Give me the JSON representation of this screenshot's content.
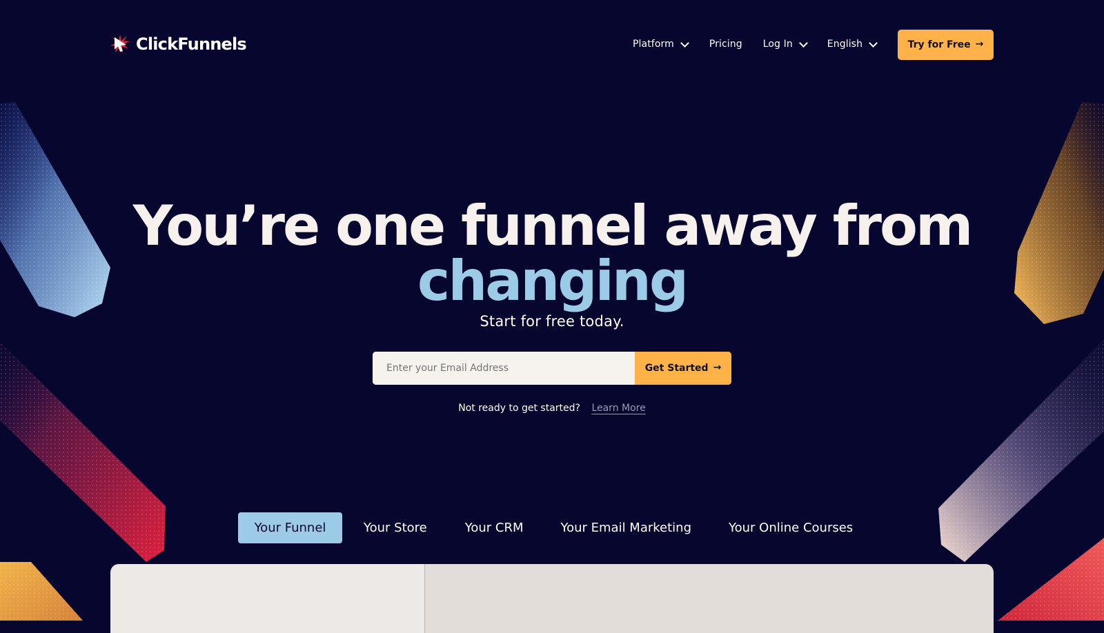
{
  "brand": {
    "name": "ClickFunnels",
    "logo_icon": "cursor-burst-icon",
    "mark_color": "#e8233f"
  },
  "nav": {
    "items": [
      {
        "label": "Platform",
        "icon": "chevron-down-icon"
      },
      {
        "label": "Pricing"
      },
      {
        "label": "Log In",
        "icon": "chevron-down-icon"
      },
      {
        "label": "English",
        "icon": "chevron-down-icon"
      }
    ],
    "cta": {
      "label": "Try for Free",
      "icon": "arrow-right-icon"
    }
  },
  "hero": {
    "title_line1": "You’re one funnel away from",
    "title_line2": "changing",
    "subtitle": "Start for free today.",
    "email_placeholder": "Enter your Email Address",
    "email_value": "",
    "submit_label": "Get Started",
    "submit_icon": "arrow-right-icon",
    "not_ready_text": "Not ready to get started?",
    "learn_more": "Learn More"
  },
  "tabs": [
    {
      "label": "Your Funnel",
      "active": true
    },
    {
      "label": "Your Store",
      "active": false
    },
    {
      "label": "Your CRM",
      "active": false
    },
    {
      "label": "Your Email Marketing",
      "active": false
    },
    {
      "label": "Your Online Courses",
      "active": false
    }
  ],
  "colors": {
    "background": "#07062f",
    "accent_orange": "#ffb247",
    "accent_blue": "#9ccbe7",
    "hero_text": "#f6f1ec",
    "link_muted": "#9b9ab5"
  }
}
